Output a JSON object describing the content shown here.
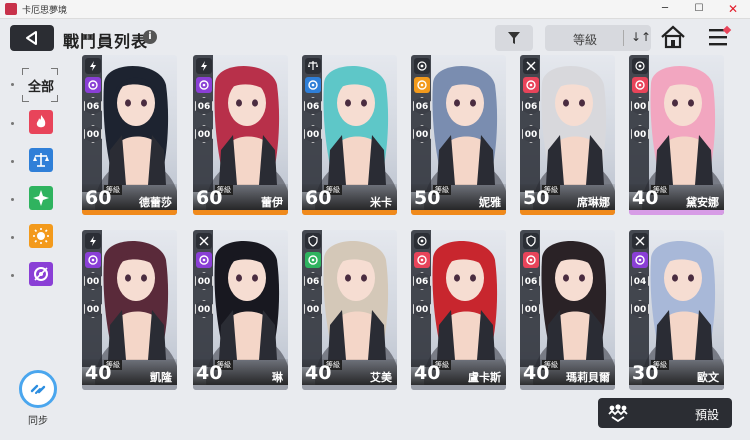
{
  "window": {
    "title": "卡厄思夢境"
  },
  "header": {
    "title": "戰鬥員列表",
    "sort_label": "等級"
  },
  "sidebar": {
    "all_label": "全部",
    "filters": [
      {
        "name": "fire",
        "color": "#e8445a"
      },
      {
        "name": "balance",
        "color": "#2f7fd8"
      },
      {
        "name": "star",
        "color": "#2fb35f"
      },
      {
        "name": "sun",
        "color": "#f39a1c"
      },
      {
        "name": "void",
        "color": "#8a3fd6"
      }
    ],
    "sync_label": "同步"
  },
  "level_label": "等級",
  "cards": [
    {
      "name": "德蕾莎",
      "level": "60",
      "class_icon": "lightning",
      "elem_color": "#8a3fd6",
      "stat1": "06",
      "stat2": "00",
      "hair": "#1d2330",
      "accent": "#f08a1c"
    },
    {
      "name": "蕾伊",
      "level": "60",
      "class_icon": "lightning",
      "elem_color": "#8a3fd6",
      "stat1": "06",
      "stat2": "00",
      "hair": "#b8304a",
      "accent": "#f08a1c"
    },
    {
      "name": "米卡",
      "level": "60",
      "class_icon": "balance",
      "elem_color": "#2f7fd8",
      "stat1": "06",
      "stat2": "00",
      "hair": "#5ec7c8",
      "accent": "#f08a1c"
    },
    {
      "name": "妮雅",
      "level": "50",
      "class_icon": "target",
      "elem_color": "#f39a1c",
      "stat1": "06",
      "stat2": "00",
      "hair": "#7a8db0",
      "accent": "#f08a1c"
    },
    {
      "name": "席琳娜",
      "level": "50",
      "class_icon": "crossed-swords",
      "elem_color": "#e8445a",
      "stat1": "06",
      "stat2": "00",
      "hair": "#d8d8dc",
      "accent": "#f08a1c"
    },
    {
      "name": "黛安娜",
      "level": "40",
      "class_icon": "target",
      "elem_color": "#e8445a",
      "stat1": "00",
      "stat2": "00",
      "hair": "#f2a6c0",
      "accent": "#d79ce6"
    },
    {
      "name": "凱隆",
      "level": "40",
      "class_icon": "lightning",
      "elem_color": "#8a3fd6",
      "stat1": "00",
      "stat2": "00",
      "hair": "#5a2a3a",
      "accent": "#9a9ea8"
    },
    {
      "name": "琳",
      "level": "40",
      "class_icon": "crossed-swords",
      "elem_color": "#8a3fd6",
      "stat1": "00",
      "stat2": "00",
      "hair": "#181820",
      "accent": "#9a9ea8"
    },
    {
      "name": "艾美",
      "level": "40",
      "class_icon": "shield",
      "elem_color": "#2fb35f",
      "stat1": "06",
      "stat2": "00",
      "hair": "#d4c8b8",
      "accent": "#9a9ea8"
    },
    {
      "name": "盧卡斯",
      "level": "40",
      "class_icon": "target",
      "elem_color": "#e8445a",
      "stat1": "06",
      "stat2": "00",
      "hair": "#c8262e",
      "accent": "#9a9ea8"
    },
    {
      "name": "瑪莉貝爾",
      "level": "40",
      "class_icon": "shield",
      "elem_color": "#e8445a",
      "stat1": "06",
      "stat2": "00",
      "hair": "#2a2226",
      "accent": "#9a9ea8"
    },
    {
      "name": "歐文",
      "level": "30",
      "class_icon": "crossed-swords",
      "elem_color": "#8a3fd6",
      "stat1": "04",
      "stat2": "00",
      "hair": "#a8b8d8",
      "accent": "#9a9ea8"
    }
  ],
  "footer": {
    "preset_label": "預設"
  }
}
